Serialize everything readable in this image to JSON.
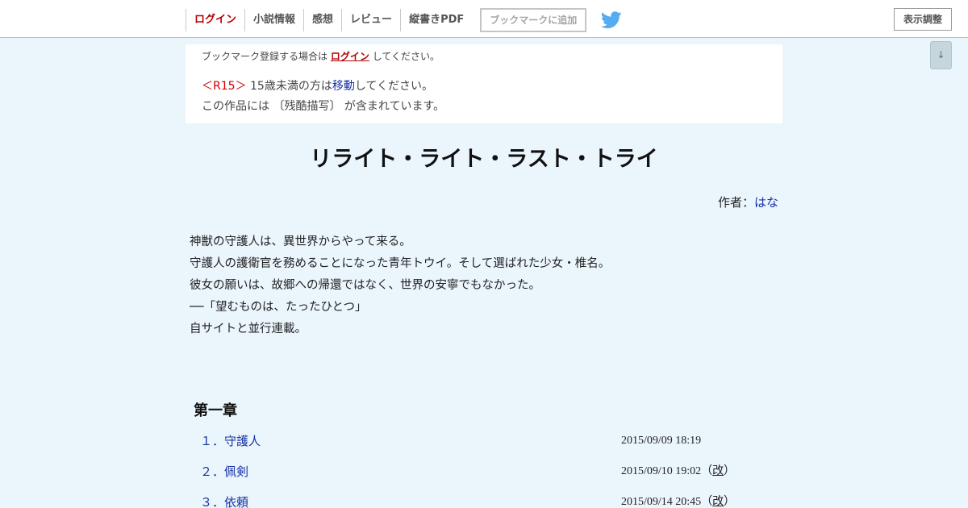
{
  "header": {
    "nav": [
      "ログイン",
      "小説情報",
      "感想",
      "レビュー",
      "縦書きPDF"
    ],
    "bookmark_add": "ブックマークに追加",
    "display_settings": "表示調整",
    "scroll_button": "↓",
    "twitter_icon": "twitter-bird",
    "accent_color": "#b40000",
    "twitter_color": "#55acee"
  },
  "notice": {
    "bookmark_prefix": "ブックマーク登録する場合は",
    "bookmark_link": "ログイン",
    "bookmark_suffix": "してください。",
    "r15_tag": "＜R15＞",
    "r15_text": "15歳未満の方は",
    "r15_link": "移動",
    "r15_suffix": "してください。",
    "warning": "この作品には 〔残酷描写〕 が含まれています。"
  },
  "novel": {
    "title": "リライト・ライト・ラスト・トライ",
    "author_label": "作者：",
    "author_name": "はな",
    "synopsis": [
      "神獣の守護人は、異世界からやって来る。",
      "守護人の護衛官を務めることになった青年トウイ。そして選ばれた少女・椎名。",
      "彼女の願いは、故郷への帰還ではなく、世界の安寧でもなかった。",
      "──「望むものは、たったひとつ」",
      "自サイトと並行連載。"
    ]
  },
  "chapter": {
    "title": "第一章",
    "episodes": [
      {
        "label": "１．守護人",
        "date": "2015/09/09 18:19",
        "revised": ""
      },
      {
        "label": "２．佩剣",
        "date": "2015/09/10 19:02",
        "revised": "改"
      },
      {
        "label": "３．依頼",
        "date": "2015/09/14 20:45",
        "revised": "改"
      }
    ]
  }
}
